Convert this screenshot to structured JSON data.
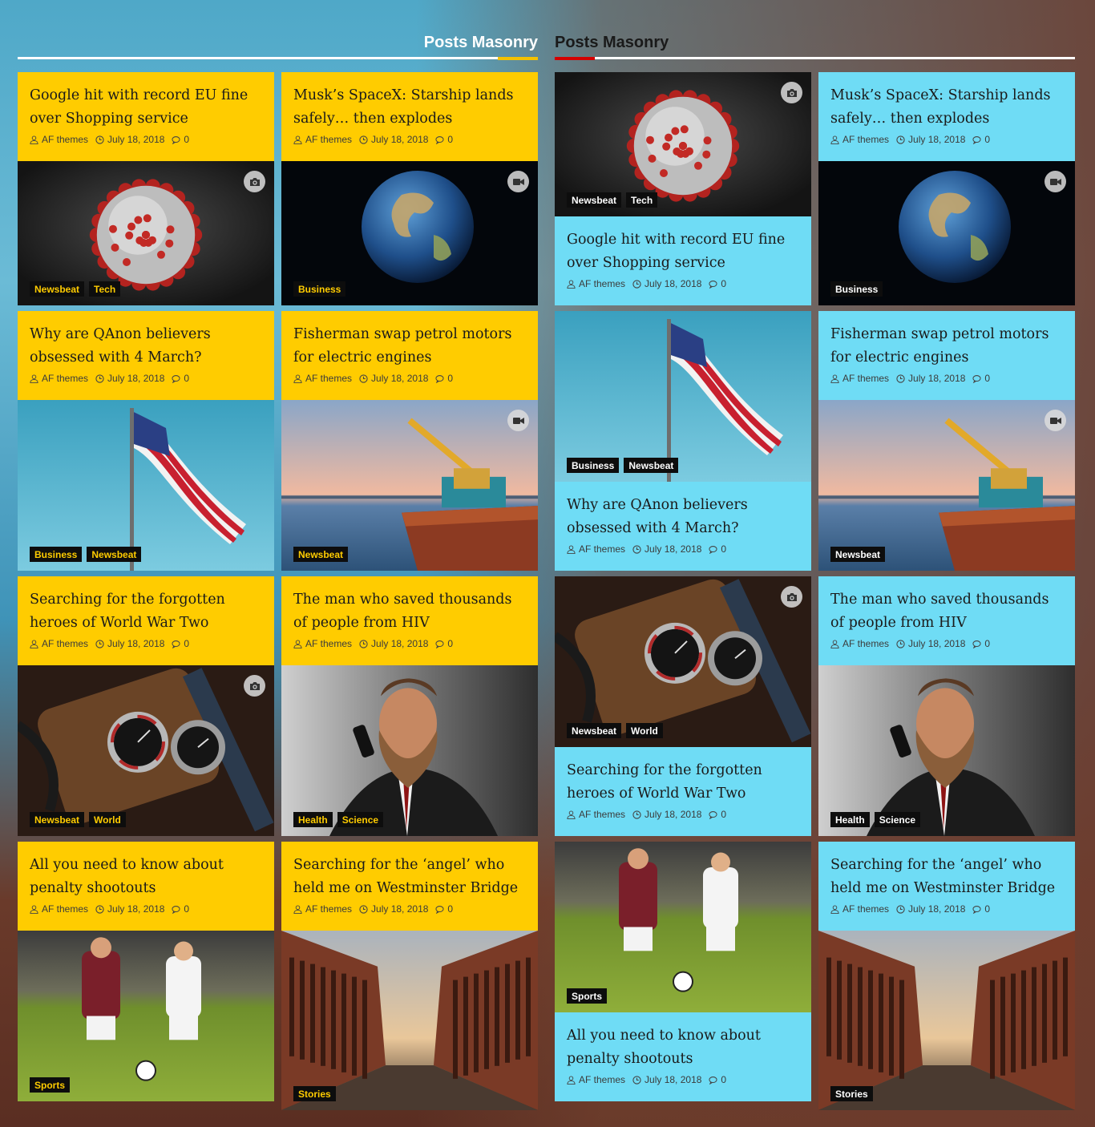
{
  "sections": [
    {
      "title": "Posts Masonry",
      "theme": "yellow",
      "accent": "#f4c100"
    },
    {
      "title": "Posts Masonry",
      "theme": "blue",
      "accent": "#d40000"
    }
  ],
  "meta": {
    "author": "AF themes",
    "date": "July 18, 2018",
    "comments": "0"
  },
  "colors": {
    "yellow_card": "#ffcc00",
    "blue_card": "#6fdcf5",
    "category_bg": "#0d0d0d"
  },
  "posts": {
    "google": {
      "title": "Google hit with record EU fine over Shopping service",
      "cats": [
        "Newsbeat",
        "Tech"
      ],
      "media": "camera-icon",
      "image": "virus"
    },
    "musk": {
      "title": "Musk’s SpaceX: Starship lands safely… then explodes",
      "cats": [
        "Business"
      ],
      "media": "video-icon",
      "image": "earth"
    },
    "qanon": {
      "title": "Why are QAnon believers obsessed with 4 March?",
      "cats": [
        "Business",
        "Newsbeat"
      ],
      "media": "",
      "image": "flag"
    },
    "fisherman": {
      "title": "Fisherman swap petrol motors for electric engines",
      "cats": [
        "Newsbeat"
      ],
      "media": "video-icon",
      "image": "boat"
    },
    "heroes": {
      "title": "Searching for the forgotten heroes of World War Two",
      "cats": [
        "Newsbeat",
        "World"
      ],
      "media": "camera-icon",
      "image": "watches"
    },
    "hiv": {
      "title": "The man who saved thousands of people from HIV",
      "cats": [
        "Health",
        "Science"
      ],
      "media": "",
      "image": "man"
    },
    "penalty": {
      "title": "All you need to know about penalty shootouts",
      "cats": [
        "Sports"
      ],
      "media": "",
      "image": "soccer"
    },
    "angel": {
      "title": "Searching for the ‘angel’ who held me on Westminster Bridge",
      "cats": [
        "Stories"
      ],
      "media": "",
      "image": "canal"
    }
  }
}
